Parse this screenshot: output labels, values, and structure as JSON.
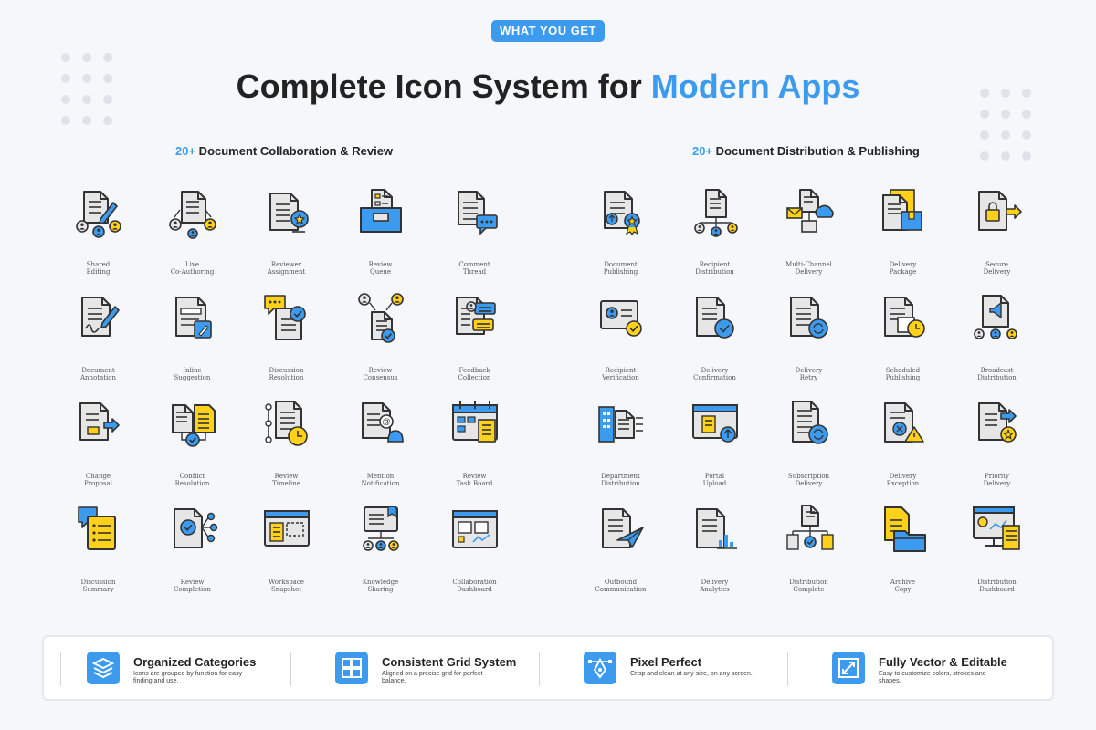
{
  "badge": "WHAT YOU GET",
  "title": {
    "main": "Complete Icon System for ",
    "accent": "Modern Apps"
  },
  "colors": {
    "accent": "#3d9bef",
    "yellow": "#ffd11a",
    "paper": "#e6e6e6",
    "outline": "#333333"
  },
  "left_section": {
    "count": "20+",
    "heading": " Document Collaboration & Review",
    "items": [
      {
        "label": "Shared\nEditing",
        "icon": "shared-editing-icon"
      },
      {
        "label": "Live\nCo-Authoring",
        "icon": "live-co-authoring-icon"
      },
      {
        "label": "Reviewer\nAssignment",
        "icon": "reviewer-assignment-icon"
      },
      {
        "label": "Review\nQueue",
        "icon": "review-queue-icon"
      },
      {
        "label": "Comment\nThread",
        "icon": "comment-thread-icon"
      },
      {
        "label": "Document\nAnnotation",
        "icon": "document-annotation-icon"
      },
      {
        "label": "Inline\nSuggestion",
        "icon": "inline-suggestion-icon"
      },
      {
        "label": "Discussion\nResolution",
        "icon": "discussion-resolution-icon"
      },
      {
        "label": "Review\nConsensus",
        "icon": "review-consensus-icon"
      },
      {
        "label": "Feedback\nCollection",
        "icon": "feedback-collection-icon"
      },
      {
        "label": "Change\nProposal",
        "icon": "change-proposal-icon"
      },
      {
        "label": "Conflict\nResolution",
        "icon": "conflict-resolution-icon"
      },
      {
        "label": "Review\nTimeline",
        "icon": "review-timeline-icon"
      },
      {
        "label": "Mention\nNotification",
        "icon": "mention-notification-icon"
      },
      {
        "label": "Review\nTask Board",
        "icon": "review-task-board-icon"
      },
      {
        "label": "Discussion\nSummary",
        "icon": "discussion-summary-icon"
      },
      {
        "label": "Review\nCompletion",
        "icon": "review-completion-icon"
      },
      {
        "label": "Workspace\nSnapshot",
        "icon": "workspace-snapshot-icon"
      },
      {
        "label": "Knowledge\nSharing",
        "icon": "knowledge-sharing-icon"
      },
      {
        "label": "Collaboration\nDashboard",
        "icon": "collaboration-dashboard-icon"
      }
    ]
  },
  "right_section": {
    "count": "20+",
    "heading": " Document Distribution & Publishing",
    "items": [
      {
        "label": "Document\nPublishing",
        "icon": "document-publishing-icon"
      },
      {
        "label": "Recipient\nDistribution",
        "icon": "recipient-distribution-icon"
      },
      {
        "label": "Multi-Channel\nDelivery",
        "icon": "multi-channel-delivery-icon"
      },
      {
        "label": "Delivery\nPackage",
        "icon": "delivery-package-icon"
      },
      {
        "label": "Secure\nDelivery",
        "icon": "secure-delivery-icon"
      },
      {
        "label": "Recipient\nVerification",
        "icon": "recipient-verification-icon"
      },
      {
        "label": "Delivery\nConfirmation",
        "icon": "delivery-confirmation-icon"
      },
      {
        "label": "Delivery\nRetry",
        "icon": "delivery-retry-icon"
      },
      {
        "label": "Scheduled\nPublishing",
        "icon": "scheduled-publishing-icon"
      },
      {
        "label": "Broadcast\nDistribution",
        "icon": "broadcast-distribution-icon"
      },
      {
        "label": "Department\nDistribution",
        "icon": "department-distribution-icon"
      },
      {
        "label": "Portal\nUpload",
        "icon": "portal-upload-icon"
      },
      {
        "label": "Subscription\nDelivery",
        "icon": "subscription-delivery-icon"
      },
      {
        "label": "Delivery\nException",
        "icon": "delivery-exception-icon"
      },
      {
        "label": "Priority\nDelivery",
        "icon": "priority-delivery-icon"
      },
      {
        "label": "Outbound\nCommunication",
        "icon": "outbound-communication-icon"
      },
      {
        "label": "Delivery\nAnalytics",
        "icon": "delivery-analytics-icon"
      },
      {
        "label": "Distribution\nComplete",
        "icon": "distribution-complete-icon"
      },
      {
        "label": "Archive\nCopy",
        "icon": "archive-copy-icon"
      },
      {
        "label": "Distribution\nDashboard",
        "icon": "distribution-dashboard-icon"
      }
    ]
  },
  "features": [
    {
      "title": "Organized Categories",
      "desc": "Icons are grouped by function for easy finding and use.",
      "icon": "layers-icon"
    },
    {
      "title": "Consistent Grid System",
      "desc": "Aligned on a precise grid for perfect balance.",
      "icon": "grid-icon"
    },
    {
      "title": "Pixel Perfect",
      "desc": "Crisp and clean at any size, on any screen.",
      "icon": "pen-tool-icon"
    },
    {
      "title": "Fully Vector & Editable",
      "desc": "Easy to customize colors, strokes and shapes.",
      "icon": "resize-icon"
    }
  ]
}
